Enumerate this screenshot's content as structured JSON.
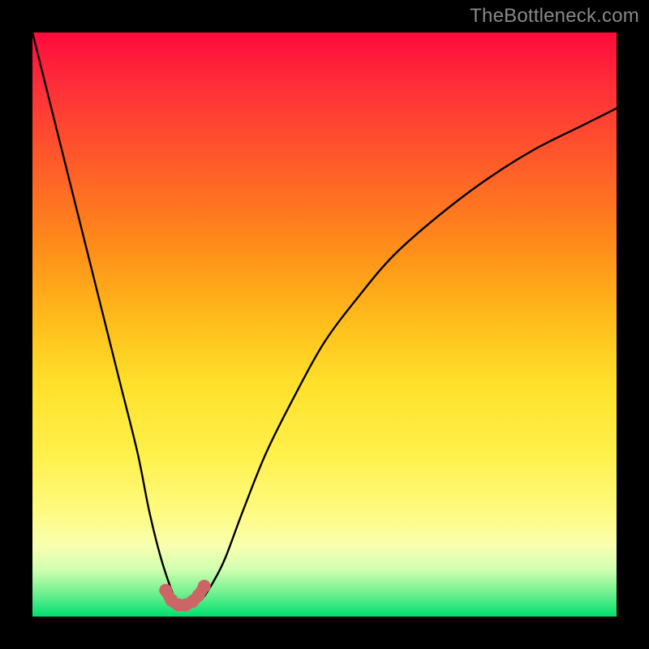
{
  "watermark": "TheBottleneck.com",
  "chart_data": {
    "type": "line",
    "title": "",
    "xlabel": "",
    "ylabel": "",
    "xlim": [
      0,
      100
    ],
    "ylim": [
      0,
      100
    ],
    "grid": false,
    "series": [
      {
        "name": "bottleneck-curve",
        "x": [
          0,
          3,
          6,
          9,
          12,
          15,
          18,
          20,
          22,
          24,
          25,
          27,
          29,
          31,
          33,
          36,
          40,
          45,
          50,
          56,
          62,
          70,
          78,
          86,
          94,
          100
        ],
        "values": [
          100,
          88,
          76,
          64,
          52,
          40,
          28,
          18,
          10,
          4,
          2,
          2,
          3,
          6,
          10,
          18,
          28,
          38,
          47,
          55,
          62,
          69,
          75,
          80,
          84,
          87
        ]
      }
    ],
    "marker_region": {
      "name": "optimal-zone",
      "x": [
        22.8,
        23.8,
        25.0,
        26.2,
        27.4,
        28.4,
        29.4
      ],
      "values": [
        4.5,
        2.8,
        2.0,
        2.0,
        2.6,
        3.6,
        5.2
      ],
      "color": "#cc6666"
    },
    "background_gradient": {
      "top": "#ff0a3a",
      "upper_mid": "#ffb81a",
      "lower_mid": "#fff04a",
      "bottom": "#00e070"
    }
  }
}
